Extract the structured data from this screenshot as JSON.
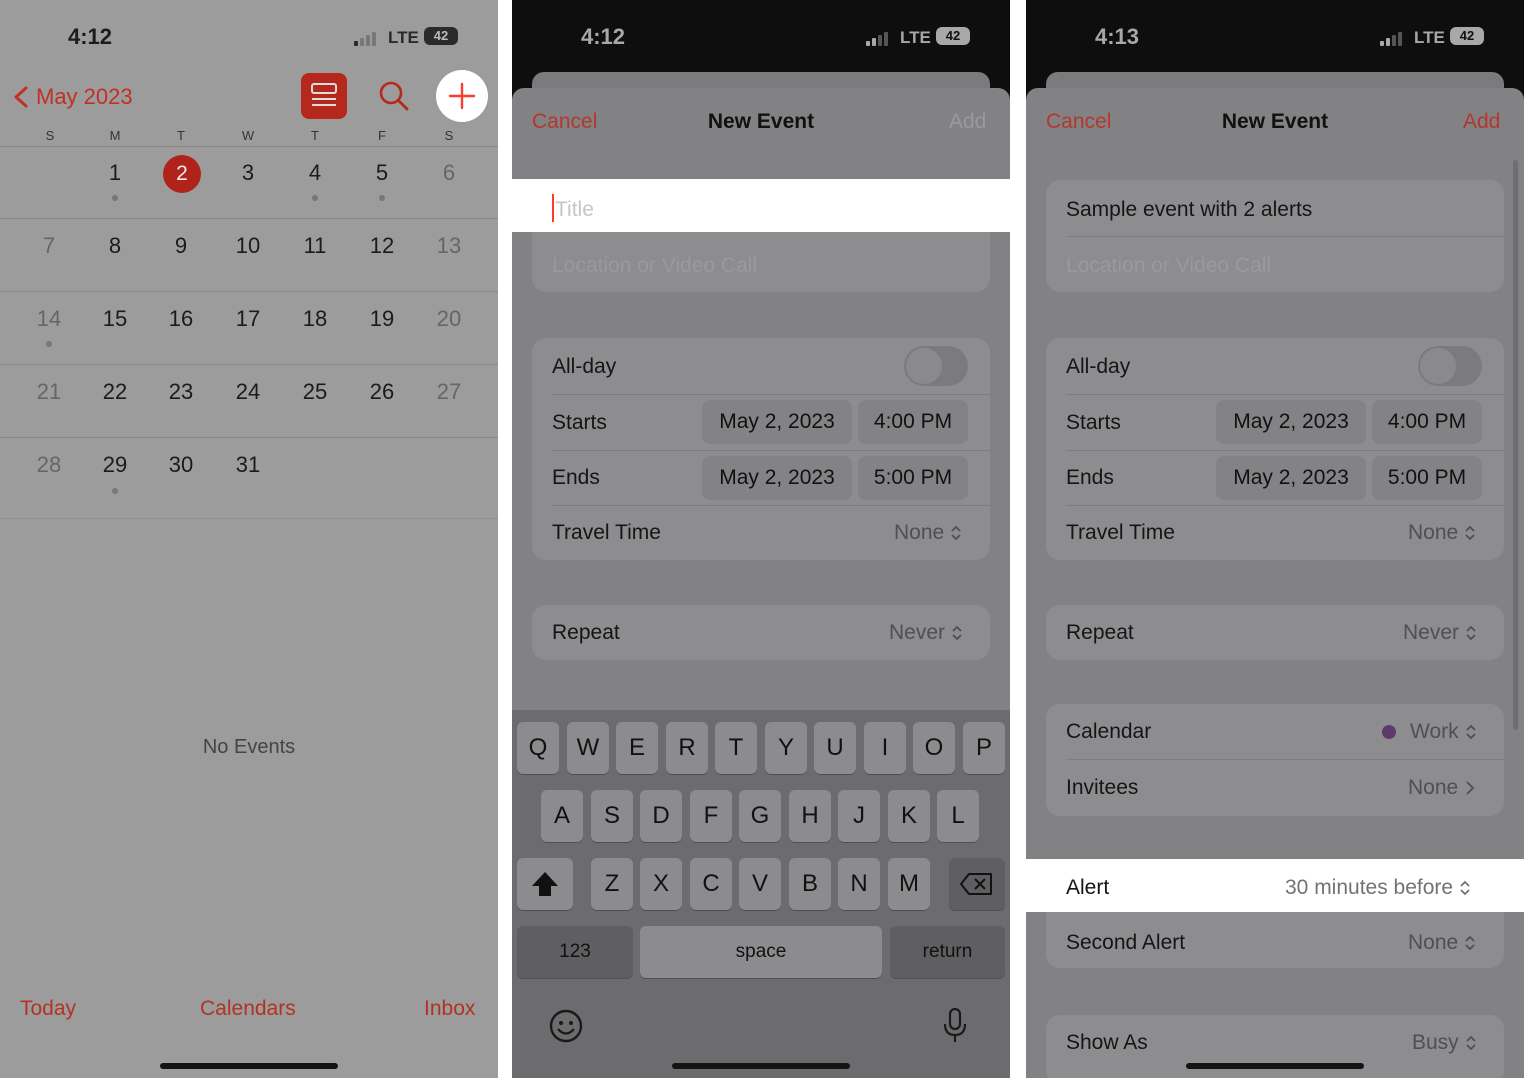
{
  "p1": {
    "status": {
      "time": "4:12",
      "network": "LTE",
      "battery": "42"
    },
    "month_title": "May 2023",
    "weekdays": [
      "S",
      "M",
      "T",
      "W",
      "T",
      "F",
      "S"
    ],
    "days": [
      "1",
      "2",
      "3",
      "4",
      "5",
      "6",
      "7",
      "8",
      "9",
      "10",
      "11",
      "12",
      "13",
      "14",
      "15",
      "16",
      "17",
      "18",
      "19",
      "20",
      "21",
      "22",
      "23",
      "24",
      "25",
      "26",
      "27",
      "28",
      "29",
      "30",
      "31"
    ],
    "no_events": "No Events",
    "tabs": {
      "today": "Today",
      "calendars": "Calendars",
      "inbox": "Inbox"
    }
  },
  "p2": {
    "status": {
      "time": "4:12",
      "network": "LTE",
      "battery": "42"
    },
    "nav": {
      "cancel": "Cancel",
      "title": "New Event",
      "add": "Add"
    },
    "title_placeholder": "Title",
    "location_placeholder": "Location or Video Call",
    "allday": "All-day",
    "starts": {
      "label": "Starts",
      "date": "May 2, 2023",
      "time": "4:00 PM"
    },
    "ends": {
      "label": "Ends",
      "date": "May 2, 2023",
      "time": "5:00 PM"
    },
    "travel": {
      "label": "Travel Time",
      "value": "None"
    },
    "repeat": {
      "label": "Repeat",
      "value": "Never"
    },
    "keyboard": {
      "row1": [
        "Q",
        "W",
        "E",
        "R",
        "T",
        "Y",
        "U",
        "I",
        "O",
        "P"
      ],
      "row2": [
        "A",
        "S",
        "D",
        "F",
        "G",
        "H",
        "J",
        "K",
        "L"
      ],
      "row3": [
        "Z",
        "X",
        "C",
        "V",
        "B",
        "N",
        "M"
      ],
      "numbers": "123",
      "space": "space",
      "return": "return"
    }
  },
  "p3": {
    "status": {
      "time": "4:13",
      "network": "LTE",
      "battery": "42"
    },
    "nav": {
      "cancel": "Cancel",
      "title": "New Event",
      "add": "Add"
    },
    "title_value": "Sample event with 2 alerts",
    "location_placeholder": "Location or Video Call",
    "allday": "All-day",
    "starts": {
      "label": "Starts",
      "date": "May 2, 2023",
      "time": "4:00 PM"
    },
    "ends": {
      "label": "Ends",
      "date": "May 2, 2023",
      "time": "5:00 PM"
    },
    "travel": {
      "label": "Travel Time",
      "value": "None"
    },
    "repeat": {
      "label": "Repeat",
      "value": "Never"
    },
    "calendar": {
      "label": "Calendar",
      "value": "Work"
    },
    "invitees": {
      "label": "Invitees",
      "value": "None"
    },
    "alert": {
      "label": "Alert",
      "value": "30 minutes before"
    },
    "second_alert": {
      "label": "Second Alert",
      "value": "None"
    },
    "show_as": {
      "label": "Show As",
      "value": "Busy"
    }
  },
  "colors": {
    "accent": "#ff3b30",
    "white": "#ffffff"
  }
}
